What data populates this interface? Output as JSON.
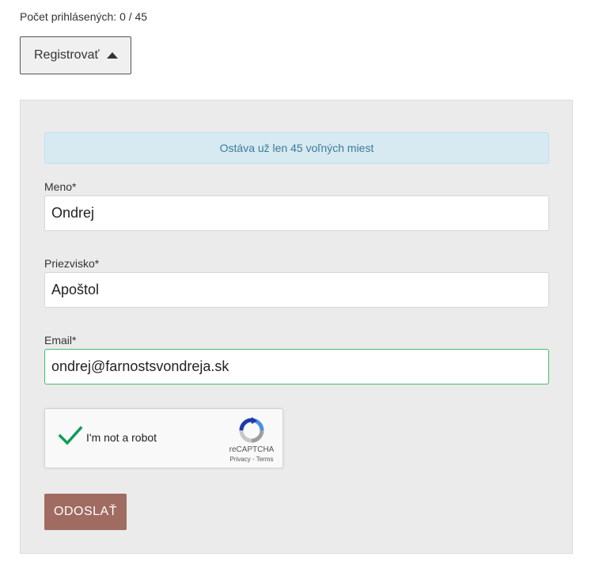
{
  "registration": {
    "count_text": "Počet prihlásených: 0 / 45",
    "toggle_label": "Registrovať"
  },
  "form": {
    "alert_text": "Ostáva už len 45 voľných miest",
    "fields": {
      "first_name": {
        "label": "Meno*",
        "value": "Ondrej"
      },
      "last_name": {
        "label": "Priezvisko*",
        "value": "Apoštol"
      },
      "email": {
        "label": "Email*",
        "value": "ondrej@farnostsvondreja.sk"
      }
    },
    "captcha": {
      "label": "I'm not a robot",
      "brand": "reCAPTCHA",
      "links": "Privacy - Terms",
      "checked": true
    },
    "submit_label": "ODOSLAŤ"
  },
  "colors": {
    "alert_bg": "#d7e9f1",
    "alert_text": "#3b7c98",
    "submit_bg": "#a06b60",
    "valid_border": "#3cc06a",
    "check": "#0f9d58"
  }
}
